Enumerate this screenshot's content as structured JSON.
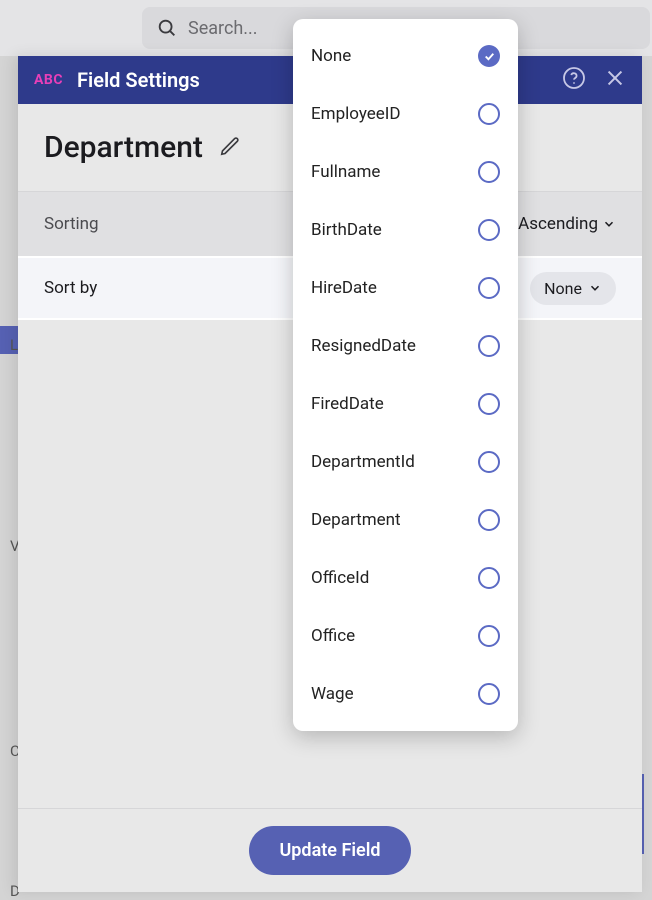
{
  "search": {
    "placeholder": "Search..."
  },
  "panel": {
    "badge": "ABC",
    "title": "Field Settings",
    "field_name": "Department",
    "sorting_label": "Sorting",
    "sort_direction": "Ascending",
    "sortby_label": "Sort by",
    "sortby_value": "None",
    "update_button": "Update Field"
  },
  "dropdown": {
    "items": [
      {
        "label": "None",
        "selected": true
      },
      {
        "label": "EmployeeID",
        "selected": false
      },
      {
        "label": "Fullname",
        "selected": false
      },
      {
        "label": "BirthDate",
        "selected": false
      },
      {
        "label": "HireDate",
        "selected": false
      },
      {
        "label": "ResignedDate",
        "selected": false
      },
      {
        "label": "FiredDate",
        "selected": false
      },
      {
        "label": "DepartmentId",
        "selected": false
      },
      {
        "label": "Department",
        "selected": false
      },
      {
        "label": "OfficeId",
        "selected": false
      },
      {
        "label": "Office",
        "selected": false
      },
      {
        "label": "Wage",
        "selected": false
      }
    ]
  },
  "bg": {
    "l1": "L",
    "l2": "V",
    "l3": "C",
    "l4": "D"
  }
}
